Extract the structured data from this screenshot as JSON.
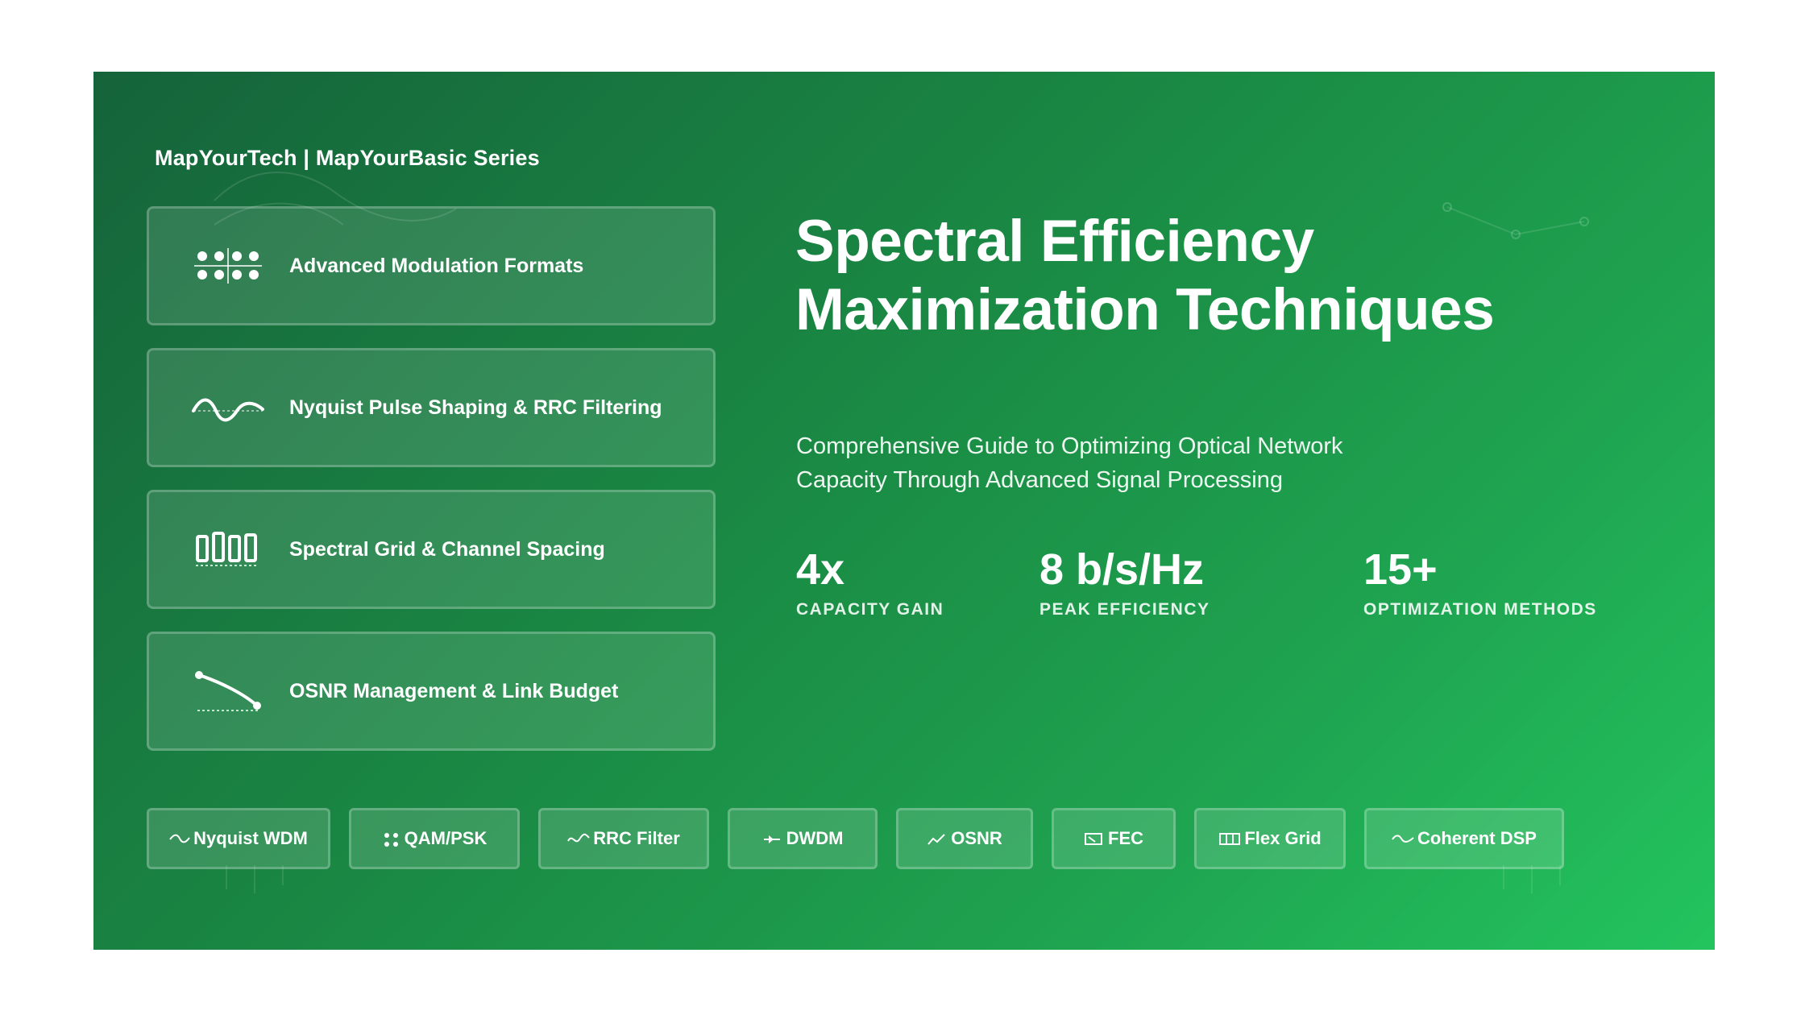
{
  "brand": "MapYourTech | MapYourBasic Series",
  "topics": [
    {
      "label": "Advanced Modulation Formats",
      "icon": "constellation-icon"
    },
    {
      "label": "Nyquist Pulse Shaping & RRC Filtering",
      "icon": "wave-icon"
    },
    {
      "label": "Spectral Grid & Channel Spacing",
      "icon": "channel-grid-icon"
    },
    {
      "label": "OSNR Management & Link Budget",
      "icon": "decay-curve-icon"
    }
  ],
  "title": {
    "line1": "Spectral Efficiency",
    "line2": "Maximization Techniques"
  },
  "subtitle": {
    "line1": "Comprehensive Guide to Optimizing Optical Network",
    "line2": "Capacity Through Advanced Signal Processing"
  },
  "stats": [
    {
      "value": "4x",
      "caption": "CAPACITY GAIN"
    },
    {
      "value": "8 b/s/Hz",
      "caption": "PEAK EFFICIENCY"
    },
    {
      "value": "15+",
      "caption": "OPTIMIZATION METHODS"
    }
  ],
  "tags": [
    {
      "label": "Nyquist WDM",
      "icon": "wave-icon"
    },
    {
      "label": "QAM/PSK",
      "icon": "dots-icon"
    },
    {
      "label": "RRC Filter",
      "icon": "wave-icon"
    },
    {
      "label": "DWDM",
      "icon": "arrow-icon"
    },
    {
      "label": "OSNR",
      "icon": "line-chart-icon"
    },
    {
      "label": "FEC",
      "icon": "box-icon"
    },
    {
      "label": "Flex Grid",
      "icon": "grid-icon"
    },
    {
      "label": "Coherent DSP",
      "icon": "wave-icon"
    }
  ],
  "colors": {
    "gradient_start": "#15633a",
    "gradient_end": "#23c45e",
    "text": "#ffffff"
  }
}
